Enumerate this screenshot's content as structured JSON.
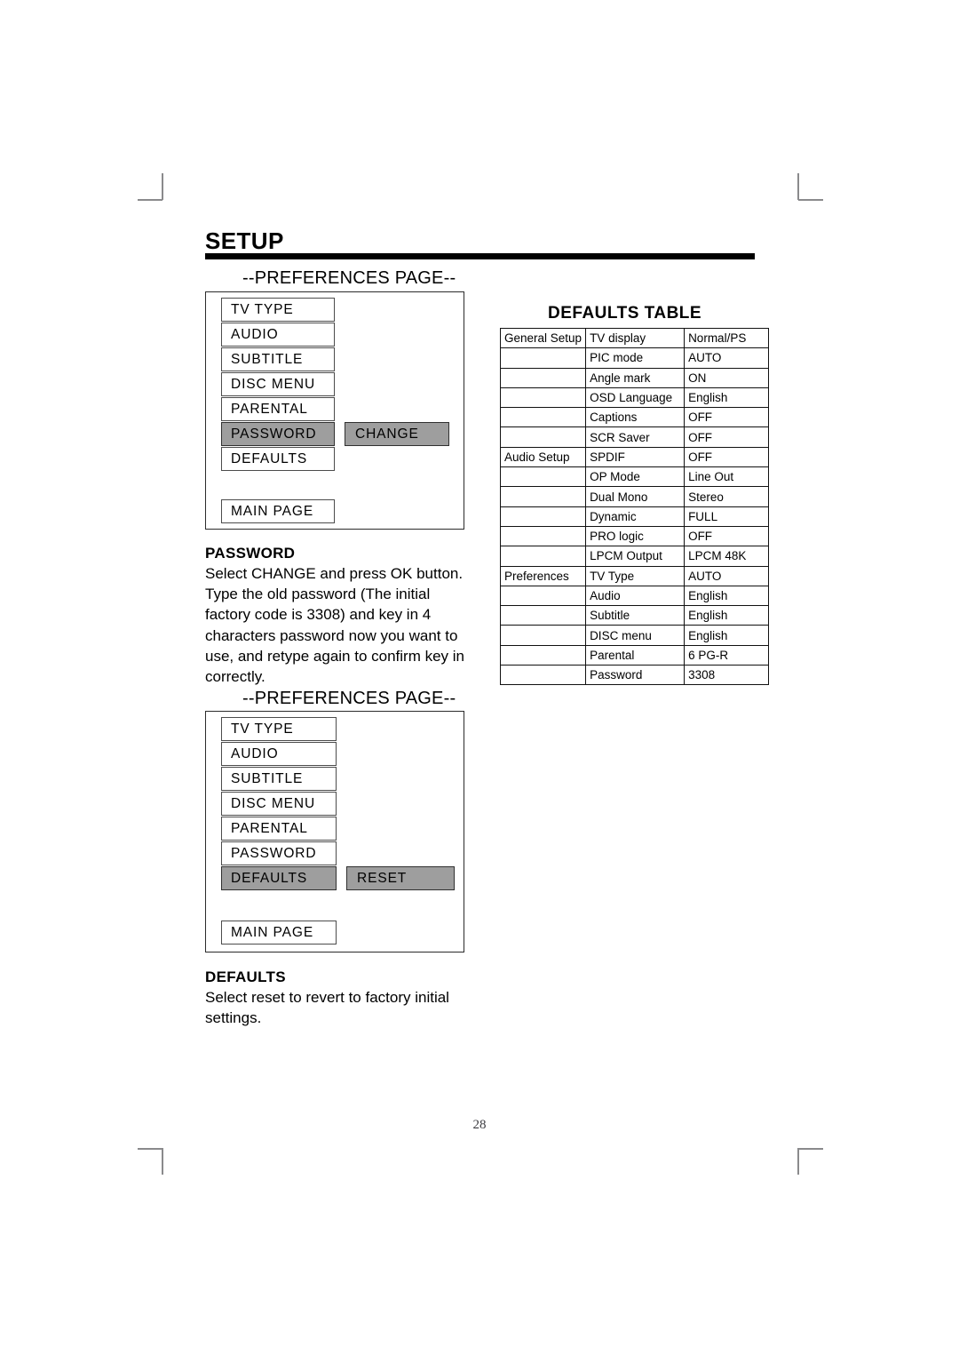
{
  "page": {
    "title": "SETUP",
    "folio": "28"
  },
  "osd_panel_password": {
    "heading": "--PREFERENCES PAGE--",
    "items": [
      {
        "label": "TV TYPE",
        "selected": false
      },
      {
        "label": "AUDIO",
        "selected": false
      },
      {
        "label": "SUBTITLE",
        "selected": false
      },
      {
        "label": "DISC MENU",
        "selected": false
      },
      {
        "label": "PARENTAL",
        "selected": false
      },
      {
        "label": "PASSWORD",
        "selected": true
      },
      {
        "label": "DEFAULTS",
        "selected": false
      }
    ],
    "action_label": "CHANGE",
    "main_page_label": "MAIN PAGE"
  },
  "osd_panel_defaults": {
    "heading": "--PREFERENCES PAGE--",
    "items": [
      {
        "label": "TV TYPE",
        "selected": false
      },
      {
        "label": "AUDIO",
        "selected": false
      },
      {
        "label": "SUBTITLE",
        "selected": false
      },
      {
        "label": "DISC MENU",
        "selected": false
      },
      {
        "label": "PARENTAL",
        "selected": false
      },
      {
        "label": "PASSWORD",
        "selected": false
      },
      {
        "label": "DEFAULTS",
        "selected": true
      }
    ],
    "action_label": "RESET",
    "main_page_label": "MAIN PAGE"
  },
  "section_password": {
    "title": "PASSWORD",
    "body": "Select CHANGE and press OK button.\nType the old password (The initial\nfactory code is 3308) and key in 4\ncharacters password now you want to\nuse, and retype again to confirm key in\ncorrectly."
  },
  "section_defaults": {
    "title": "DEFAULTS",
    "body": "Select reset to revert to factory initial\nsettings."
  },
  "defaults_table": {
    "title": "DEFAULTS TABLE",
    "rows": [
      {
        "group": "General Setup",
        "setting": "TV display",
        "value": "Normal/PS"
      },
      {
        "group": "",
        "setting": "PIC mode",
        "value": "AUTO"
      },
      {
        "group": "",
        "setting": "Angle mark",
        "value": "ON"
      },
      {
        "group": "",
        "setting": "OSD Language",
        "value": "English"
      },
      {
        "group": "",
        "setting": "Captions",
        "value": "OFF"
      },
      {
        "group": "",
        "setting": "SCR Saver",
        "value": "OFF"
      },
      {
        "group": "Audio Setup",
        "setting": "SPDIF",
        "value": "OFF"
      },
      {
        "group": "",
        "setting": "OP Mode",
        "value": "Line Out"
      },
      {
        "group": "",
        "setting": "Dual Mono",
        "value": "Stereo"
      },
      {
        "group": "",
        "setting": "Dynamic",
        "value": "FULL"
      },
      {
        "group": "",
        "setting": "PRO logic",
        "value": "OFF"
      },
      {
        "group": "",
        "setting": "LPCM Output",
        "value": "LPCM 48K"
      },
      {
        "group": "Preferences",
        "setting": "TV Type",
        "value": "AUTO"
      },
      {
        "group": "",
        "setting": "Audio",
        "value": "English"
      },
      {
        "group": "",
        "setting": "Subtitle",
        "value": "English"
      },
      {
        "group": "",
        "setting": "DISC menu",
        "value": "English"
      },
      {
        "group": "",
        "setting": "Parental",
        "value": "6 PG-R"
      },
      {
        "group": "",
        "setting": "Password",
        "value": "3308"
      }
    ]
  },
  "colors": {
    "selection_fill": "#9e9e9e",
    "rule": "#000000",
    "crop_mark": "#8a8a8c"
  }
}
